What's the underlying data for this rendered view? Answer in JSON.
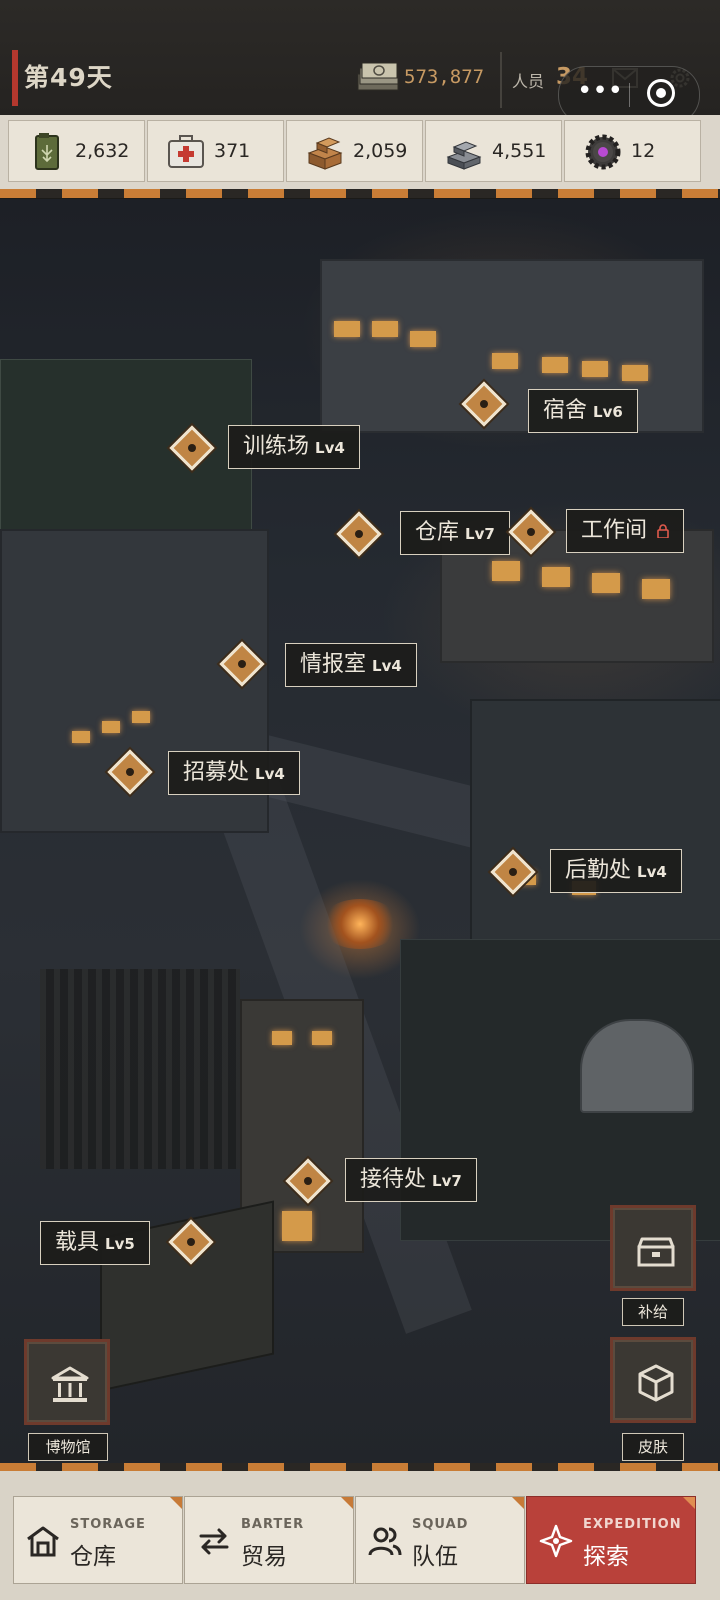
{
  "header": {
    "day_label": "第49天",
    "cash_value": "573,877",
    "personnel_label": "人员",
    "personnel_value": "34"
  },
  "resources": [
    {
      "icon": "fuel-can-icon",
      "value": "2,632"
    },
    {
      "icon": "medkit-icon",
      "value": "371"
    },
    {
      "icon": "wood-planks-icon",
      "value": "2,059"
    },
    {
      "icon": "steel-ingot-icon",
      "value": "4,551"
    },
    {
      "icon": "gear-part-icon",
      "value": "12"
    }
  ],
  "buildings": {
    "dorm": {
      "name": "宿舍",
      "level": "Lv6"
    },
    "training": {
      "name": "训练场",
      "level": "Lv4"
    },
    "warehouse": {
      "name": "仓库",
      "level": "Lv7"
    },
    "workshop": {
      "name": "工作间",
      "level": ""
    },
    "intel": {
      "name": "情报室",
      "level": "Lv4"
    },
    "recruit": {
      "name": "招募处",
      "level": "Lv4"
    },
    "logistics": {
      "name": "后勤处",
      "level": "Lv4"
    },
    "reception": {
      "name": "接待处",
      "level": "Lv7"
    },
    "vehicle": {
      "name": "载具",
      "level": "Lv5"
    }
  },
  "side_buttons": {
    "supply_label": "补给",
    "skins_label": "皮肤",
    "museum_label": "博物馆"
  },
  "bottom_nav": [
    {
      "en": "STORAGE",
      "cn": "仓库"
    },
    {
      "en": "BARTER",
      "cn": "贸易"
    },
    {
      "en": "SQUAD",
      "cn": "队伍"
    },
    {
      "en": "EXPEDITION",
      "cn": "探索"
    }
  ],
  "colors": {
    "accent_orange": "#c08544",
    "active_red": "#b9413a",
    "cash_gold": "#c79a63"
  }
}
